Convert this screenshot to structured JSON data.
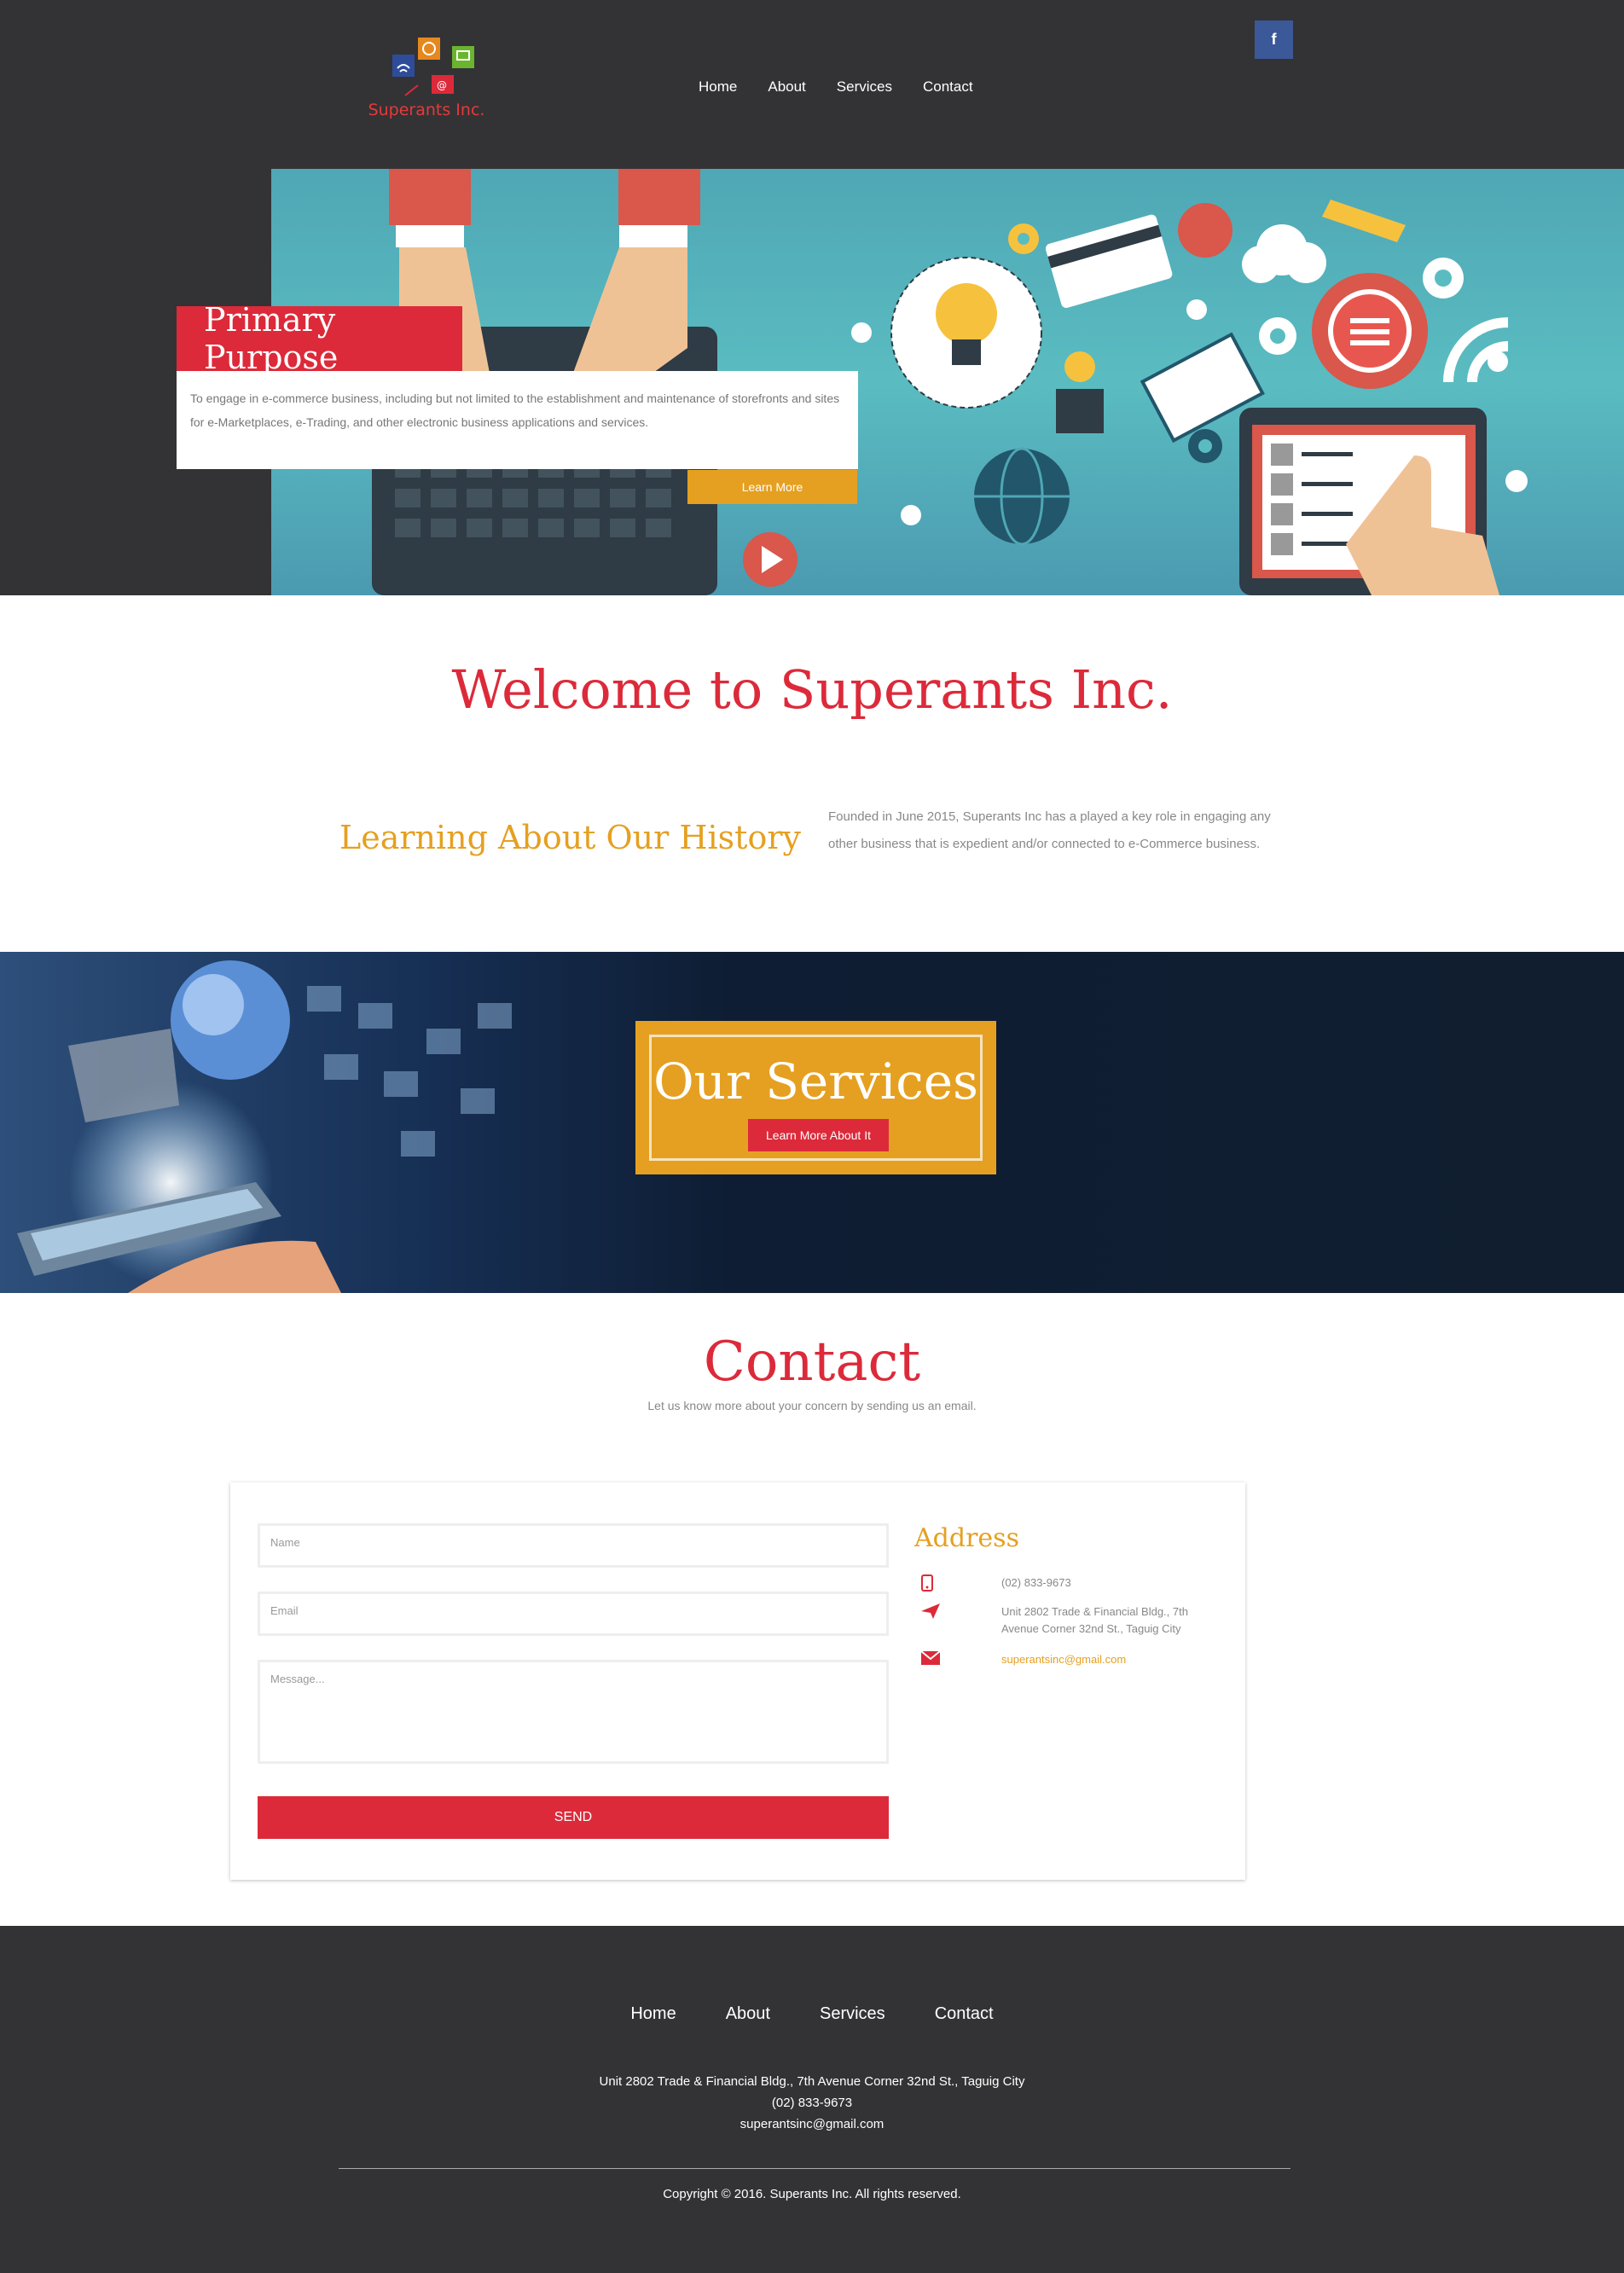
{
  "header": {
    "logo_text": "Superants Inc.",
    "nav": [
      "Home",
      "About",
      "Services",
      "Contact"
    ],
    "social": "f"
  },
  "hero": {
    "title": "Primary Purpose",
    "text": "To engage in e-commerce business, including but not limited to the establishment and maintenance of storefronts and sites for e-Marketplaces, e-Trading, and other electronic business applications and services.",
    "button": "Learn More"
  },
  "welcome": {
    "title": "Welcome to Superants Inc.",
    "history_title": "Learning About Our History",
    "history_text": "Founded in June 2015, Superants Inc has a played a key role in engaging any other business that is expedient and/or connected to e-Commerce business."
  },
  "services": {
    "title": "Our Services",
    "button": "Learn More About It"
  },
  "contact": {
    "title": "Contact",
    "subtitle": "Let us know more about your concern by sending us an email.",
    "name_placeholder": "Name",
    "email_placeholder": "Email",
    "message_placeholder": "Message...",
    "send": "SEND",
    "address_title": "Address",
    "phone": "(02) 833-9673",
    "address": "Unit 2802 Trade & Financial Bldg., 7th Avenue Corner 32nd St., Taguig City",
    "email": "superantsinc@gmail.com"
  },
  "footer": {
    "nav": [
      "Home",
      "About",
      "Services",
      "Contact"
    ],
    "address": "Unit 2802 Trade & Financial Bldg., 7th Avenue Corner 32nd St., Taguig City",
    "phone": "(02) 833-9673",
    "email": "superantsinc@gmail.com",
    "copyright": "Copyright © 2016. Superants Inc. All rights reserved."
  },
  "colors": {
    "red": "#dc2a3a",
    "orange": "#e5a021",
    "dark": "#333335",
    "facebook": "#3b5998"
  }
}
